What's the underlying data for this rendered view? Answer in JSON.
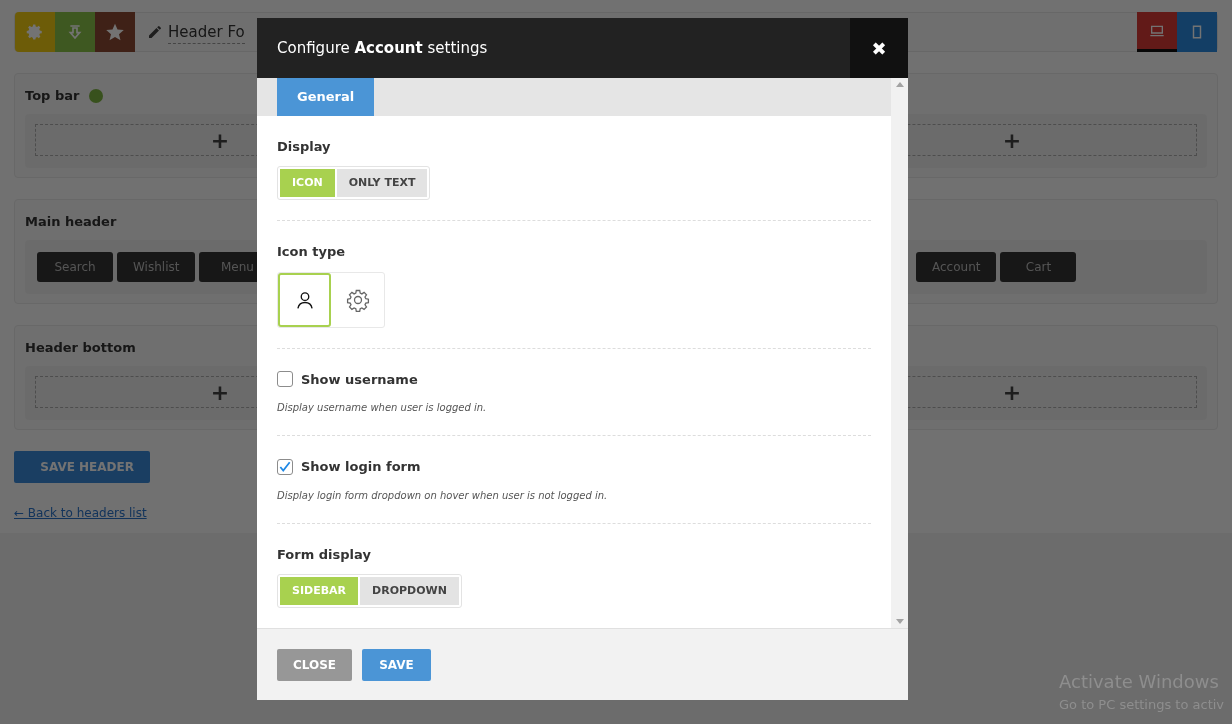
{
  "toolbar": {
    "title": "Header Fo",
    "devices": [
      {
        "kind": "desktop",
        "selected": true
      },
      {
        "kind": "mobile",
        "selected": false
      }
    ]
  },
  "rows": [
    {
      "title": "Top bar",
      "status_dot": true,
      "columns": [
        {
          "kind": "add",
          "label": "+"
        },
        {
          "kind": "add",
          "label": "+"
        }
      ]
    },
    {
      "title": "Main header",
      "status_dot": false,
      "columns": [
        {
          "kind": "items",
          "items": [
            "Search",
            "Wishlist",
            "Menu"
          ]
        },
        {
          "kind": "items",
          "items": [
            "Account",
            "Cart"
          ]
        }
      ]
    },
    {
      "title": "Header bottom",
      "status_dot": false,
      "columns": [
        {
          "kind": "add",
          "label": "+"
        },
        {
          "kind": "add",
          "label": "+"
        }
      ]
    }
  ],
  "save_header_button": "SAVE HEADER",
  "back_link": "← Back to headers list",
  "modal": {
    "title": "Configure **Account** settings",
    "close_icon": "✖",
    "tabs": [
      {
        "label": "General",
        "selected": true
      }
    ],
    "fields": [
      {
        "kind": "segmented",
        "label": "Display",
        "options": [
          {
            "label": "ICON",
            "selected": true
          },
          {
            "label": "ONLY TEXT",
            "selected": false
          }
        ]
      },
      {
        "kind": "icons",
        "label": "Icon type",
        "options": [
          {
            "kind": "person",
            "selected": true
          },
          {
            "kind": "gear",
            "selected": false
          }
        ]
      },
      {
        "kind": "checkbox",
        "label": "Show username",
        "checked": false,
        "description": "Display username when user is logged in."
      },
      {
        "kind": "checkbox",
        "label": "Show login form",
        "checked": true,
        "description": "Display login form dropdown on hover when user is not logged in."
      },
      {
        "kind": "segmented",
        "label": "Form display",
        "options": [
          {
            "label": "SIDEBAR",
            "selected": true
          },
          {
            "label": "DROPDOWN",
            "selected": false
          }
        ]
      }
    ],
    "buttons": [
      {
        "kind": "close",
        "label": "CLOSE"
      },
      {
        "kind": "save",
        "label": "SAVE"
      }
    ]
  },
  "os_notice": {
    "title": "Activate Windows",
    "subtitle": "Go to PC settings to activ"
  }
}
